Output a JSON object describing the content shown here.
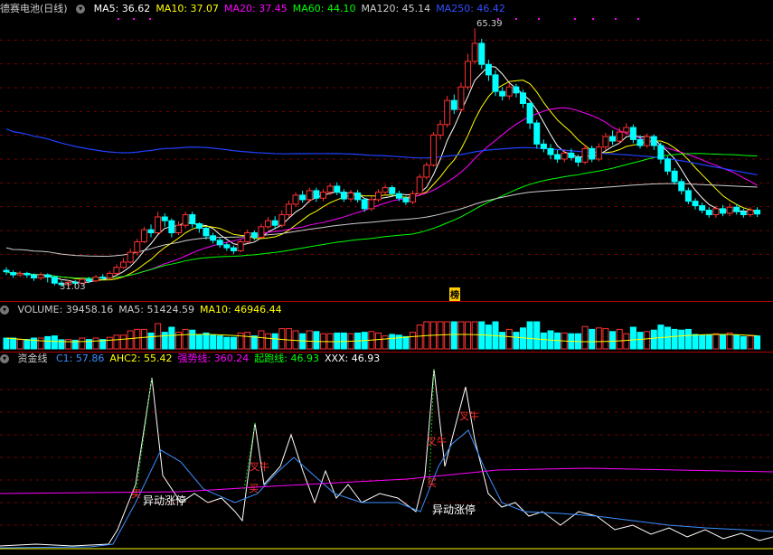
{
  "main_panel": {
    "title": "德赛电池(日线)",
    "ma_items": [
      {
        "label": "MA5: 36.62",
        "color": "#ffffff"
      },
      {
        "label": "MA10: 37.07",
        "color": "#ffff00"
      },
      {
        "label": "MA20: 37.45",
        "color": "#ff00ff"
      },
      {
        "label": "MA60: 44.10",
        "color": "#00ff00"
      },
      {
        "label": "MA120: 45.14",
        "color": "#cccccc"
      },
      {
        "label": "MA250: 46.42",
        "color": "#3050ff"
      }
    ],
    "high_label": "65.39",
    "low_label": "31.03",
    "badge": "榜"
  },
  "volume_panel": {
    "items": [
      {
        "label": "VOLUME: 39458.16",
        "color": "#cccccc"
      },
      {
        "label": "MA5: 51424.59",
        "color": "#cccccc"
      },
      {
        "label": "MA10: 46946.44",
        "color": "#ffff00"
      }
    ]
  },
  "indicator_panel": {
    "title": "资金线",
    "items": [
      {
        "label": "C1: 57.86",
        "color": "#3a8fff"
      },
      {
        "label": "AHC2: 55.42",
        "color": "#ffff00"
      },
      {
        "label": "强势线: 360.24",
        "color": "#ff00ff"
      },
      {
        "label": "起跑线: 46.93",
        "color": "#00ff00"
      },
      {
        "label": "XXX: 46.93",
        "color": "#ffffff"
      }
    ],
    "annotations": [
      {
        "text": "异动涨停",
        "color": "#ffffff"
      },
      {
        "text": "异动涨停",
        "color": "#ffffff"
      },
      {
        "text": "买",
        "color": "#ff3030"
      },
      {
        "text": "买",
        "color": "#ff3030"
      },
      {
        "text": "买",
        "color": "#ff3030"
      },
      {
        "text": "叉牛",
        "color": "#ff3030"
      },
      {
        "text": "叉牛",
        "color": "#ff3030"
      },
      {
        "text": "叉牛",
        "color": "#ff3030"
      }
    ]
  },
  "chart_data": {
    "type": "candlestick",
    "ylim": [
      29,
      67
    ],
    "candles": [
      [
        33.2,
        33.0,
        33.6,
        32.6
      ],
      [
        32.9,
        32.6,
        33.2,
        32.2
      ],
      [
        32.6,
        32.8,
        33.1,
        32.3
      ],
      [
        32.8,
        32.6,
        33.0,
        32.2
      ],
      [
        32.6,
        32.2,
        32.8,
        31.8
      ],
      [
        32.2,
        32.6,
        32.9,
        31.9
      ],
      [
        32.6,
        32.3,
        32.8,
        31.6
      ],
      [
        32.3,
        31.5,
        32.5,
        31.2
      ],
      [
        31.5,
        31.3,
        31.8,
        31.03
      ],
      [
        31.3,
        31.6,
        31.9,
        31.1
      ],
      [
        31.6,
        31.5,
        31.9,
        31.2
      ],
      [
        31.5,
        32.0,
        32.3,
        31.3
      ],
      [
        32.0,
        31.8,
        32.3,
        31.5
      ],
      [
        31.8,
        32.3,
        32.6,
        31.6
      ],
      [
        32.3,
        32.2,
        32.7,
        31.9
      ],
      [
        32.2,
        32.8,
        33.1,
        32.0
      ],
      [
        32.8,
        33.6,
        34.0,
        32.6
      ],
      [
        33.6,
        34.3,
        34.8,
        33.4
      ],
      [
        34.3,
        35.6,
        36.1,
        34.1
      ],
      [
        35.6,
        37.0,
        37.4,
        35.2
      ],
      [
        37.0,
        38.6,
        39.0,
        36.8
      ],
      [
        38.6,
        38.2,
        39.3,
        37.6
      ],
      [
        38.2,
        40.3,
        41.0,
        38.0
      ],
      [
        40.3,
        39.8,
        40.8,
        39.0
      ],
      [
        39.8,
        38.2,
        40.1,
        37.6
      ],
      [
        38.2,
        39.2,
        39.7,
        37.9
      ],
      [
        39.2,
        40.6,
        41.0,
        38.8
      ],
      [
        40.6,
        39.4,
        41.0,
        38.9
      ],
      [
        39.4,
        38.8,
        39.6,
        38.2
      ],
      [
        38.8,
        37.8,
        39.0,
        37.3
      ],
      [
        37.8,
        37.2,
        38.2,
        36.8
      ],
      [
        37.2,
        36.6,
        37.5,
        36.2
      ],
      [
        36.6,
        36.2,
        36.9,
        35.8
      ],
      [
        36.2,
        35.8,
        36.5,
        35.4
      ],
      [
        35.8,
        37.0,
        37.3,
        35.6
      ],
      [
        37.0,
        38.2,
        38.6,
        36.8
      ],
      [
        38.2,
        37.6,
        38.5,
        37.2
      ],
      [
        37.6,
        39.0,
        39.4,
        37.4
      ],
      [
        39.0,
        39.8,
        40.3,
        38.7
      ],
      [
        39.8,
        39.2,
        40.4,
        38.8
      ],
      [
        39.2,
        40.6,
        41.2,
        38.9
      ],
      [
        40.6,
        42.0,
        42.5,
        40.2
      ],
      [
        42.0,
        43.2,
        43.6,
        41.6
      ],
      [
        43.2,
        42.6,
        43.8,
        42.2
      ],
      [
        42.6,
        43.8,
        44.2,
        42.2
      ],
      [
        43.8,
        42.8,
        44.2,
        42.3
      ],
      [
        42.8,
        43.6,
        44.0,
        42.4
      ],
      [
        43.6,
        44.4,
        44.8,
        43.2
      ],
      [
        44.4,
        43.6,
        44.9,
        43.2
      ],
      [
        43.6,
        42.7,
        44.0,
        42.3
      ],
      [
        42.7,
        43.5,
        43.9,
        42.3
      ],
      [
        43.5,
        42.6,
        43.9,
        42.2
      ],
      [
        42.6,
        41.4,
        42.8,
        41.0
      ],
      [
        41.4,
        42.6,
        43.0,
        41.1
      ],
      [
        42.6,
        43.6,
        44.0,
        42.3
      ],
      [
        43.6,
        44.2,
        44.6,
        43.3
      ],
      [
        44.2,
        43.4,
        44.5,
        43.0
      ],
      [
        43.4,
        42.8,
        43.8,
        42.4
      ],
      [
        42.8,
        42.3,
        43.1,
        41.9
      ],
      [
        42.3,
        43.4,
        43.8,
        42.0
      ],
      [
        43.4,
        45.6,
        46.0,
        43.2
      ],
      [
        45.6,
        47.2,
        47.6,
        45.3
      ],
      [
        47.2,
        51.2,
        51.6,
        47.0
      ],
      [
        51.2,
        52.6,
        53.2,
        50.6
      ],
      [
        52.6,
        55.8,
        56.4,
        52.2
      ],
      [
        55.8,
        54.6,
        56.6,
        54.0
      ],
      [
        54.6,
        57.6,
        58.2,
        54.3
      ],
      [
        57.6,
        61.0,
        62.0,
        57.2
      ],
      [
        61.0,
        63.4,
        65.39,
        60.6
      ],
      [
        63.4,
        60.6,
        64.0,
        60.0
      ],
      [
        60.6,
        59.2,
        61.2,
        58.4
      ],
      [
        59.2,
        57.0,
        59.8,
        56.4
      ],
      [
        57.0,
        56.4,
        57.6,
        55.8
      ],
      [
        56.4,
        57.6,
        58.1,
        55.9
      ],
      [
        57.6,
        56.8,
        58.0,
        56.2
      ],
      [
        56.8,
        55.4,
        57.2,
        54.8
      ],
      [
        55.4,
        52.8,
        55.6,
        52.0
      ],
      [
        52.8,
        50.0,
        53.2,
        49.4
      ],
      [
        50.0,
        49.4,
        50.6,
        48.9
      ],
      [
        49.4,
        48.6,
        50.0,
        48.0
      ],
      [
        48.6,
        48.0,
        49.2,
        47.5
      ],
      [
        48.0,
        48.8,
        49.3,
        47.6
      ],
      [
        48.8,
        48.2,
        49.4,
        47.8
      ],
      [
        48.2,
        47.6,
        48.6,
        47.0
      ],
      [
        47.6,
        49.4,
        49.9,
        47.3
      ],
      [
        49.4,
        48.0,
        49.8,
        47.6
      ],
      [
        48.0,
        49.6,
        50.1,
        47.7
      ],
      [
        49.6,
        51.0,
        51.5,
        49.2
      ],
      [
        51.0,
        50.4,
        51.8,
        49.9
      ],
      [
        50.4,
        51.6,
        52.2,
        50.0
      ],
      [
        51.6,
        52.2,
        52.8,
        51.2
      ],
      [
        52.2,
        50.6,
        52.6,
        50.1
      ],
      [
        50.6,
        49.8,
        51.2,
        49.4
      ],
      [
        49.8,
        51.0,
        51.4,
        49.5
      ],
      [
        51.0,
        49.8,
        51.3,
        49.2
      ],
      [
        49.8,
        48.0,
        50.2,
        47.4
      ],
      [
        48.0,
        46.4,
        48.4,
        45.9
      ],
      [
        46.4,
        45.0,
        46.8,
        44.6
      ],
      [
        45.0,
        43.8,
        45.4,
        43.3
      ],
      [
        43.8,
        42.4,
        44.2,
        42.0
      ],
      [
        42.4,
        41.8,
        42.8,
        41.3
      ],
      [
        41.8,
        41.2,
        42.2,
        40.8
      ],
      [
        41.2,
        40.6,
        41.6,
        40.2
      ],
      [
        40.6,
        41.4,
        41.8,
        40.2
      ],
      [
        41.4,
        40.8,
        41.9,
        40.4
      ],
      [
        40.8,
        41.6,
        42.1,
        40.4
      ],
      [
        41.6,
        41.0,
        42.0,
        40.6
      ],
      [
        41.0,
        40.6,
        41.4,
        40.2
      ],
      [
        40.6,
        41.2,
        41.6,
        40.3
      ],
      [
        41.2,
        40.7,
        41.6,
        40.3
      ]
    ]
  }
}
